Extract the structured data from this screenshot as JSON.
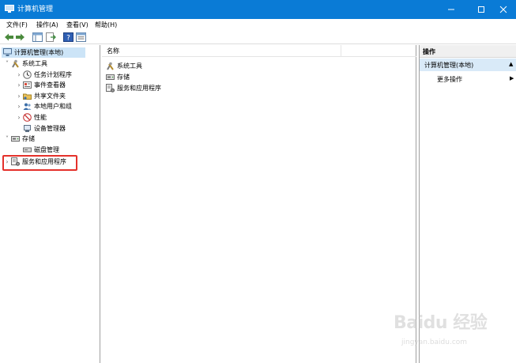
{
  "window": {
    "title": "计算机管理",
    "controls": [
      "minimize-icon",
      "maximize-icon",
      "close-icon"
    ]
  },
  "menu": [
    "文件(F)",
    "操作(A)",
    "查看(V)",
    "帮助(H)"
  ],
  "toolbar": {
    "buttons": [
      "back-arrow-icon",
      "forward-arrow-icon",
      "show-hide-console-tree-icon",
      "export-list-icon",
      "help-icon",
      "properties-icon"
    ]
  },
  "tree": {
    "root": "计算机管理(本地)",
    "system_tools": "系统工具",
    "task_scheduler": "任务计划程序",
    "event_viewer": "事件查看器",
    "shared_folders": "共享文件夹",
    "local_users": "本地用户和组",
    "performance": "性能",
    "device_manager": "设备管理器",
    "storage": "存储",
    "disk_management": "磁盘管理",
    "services_apps": "服务和应用程序"
  },
  "center": {
    "column_name": "名称",
    "items": [
      "系统工具",
      "存储",
      "服务和应用程序"
    ]
  },
  "actions": {
    "header": "操作",
    "section": "计算机管理(本地)",
    "more": "更多操作"
  },
  "watermark": {
    "logo": "Baidu 经验",
    "url": "jingyan.baidu.com"
  },
  "colors": {
    "titlebar": "#0a7bd6",
    "selection": "#cce4f7",
    "highlight_box": "#e4312b"
  }
}
